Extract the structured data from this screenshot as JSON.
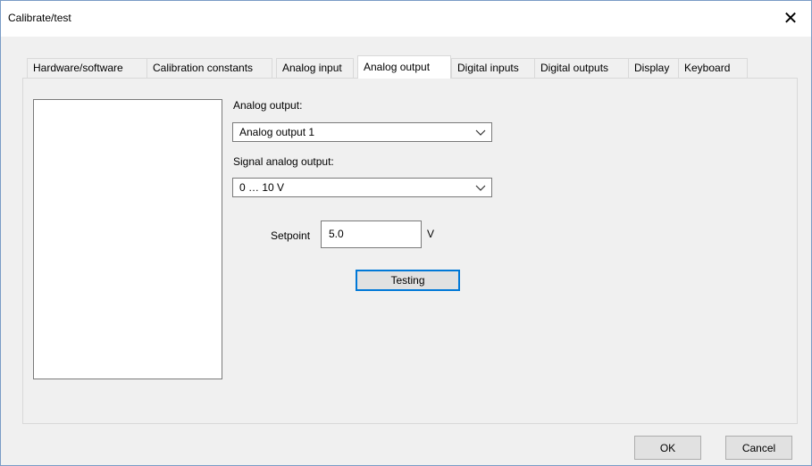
{
  "window": {
    "title": "Calibrate/test",
    "close_glyph": "✕"
  },
  "tabs": [
    {
      "label": "Hardware/software"
    },
    {
      "label": "Calibration constants"
    },
    {
      "label": "Analog input"
    },
    {
      "label": "Analog output",
      "active": true
    },
    {
      "label": "Digital inputs"
    },
    {
      "label": "Digital outputs"
    },
    {
      "label": "Display"
    },
    {
      "label": "Keyboard"
    }
  ],
  "analog_output": {
    "label": "Analog output:",
    "selected": "Analog output 1"
  },
  "signal_output": {
    "label": "Signal analog output:",
    "selected": "0 … 10 V"
  },
  "setpoint": {
    "label": "Setpoint",
    "value": "5.0",
    "unit": "V"
  },
  "testing_button": "Testing",
  "footer": {
    "ok": "OK",
    "cancel": "Cancel"
  },
  "colors": {
    "accent": "#0078d7",
    "window_border": "#7a9cc6",
    "dialog_bg": "#f0f0f0"
  }
}
